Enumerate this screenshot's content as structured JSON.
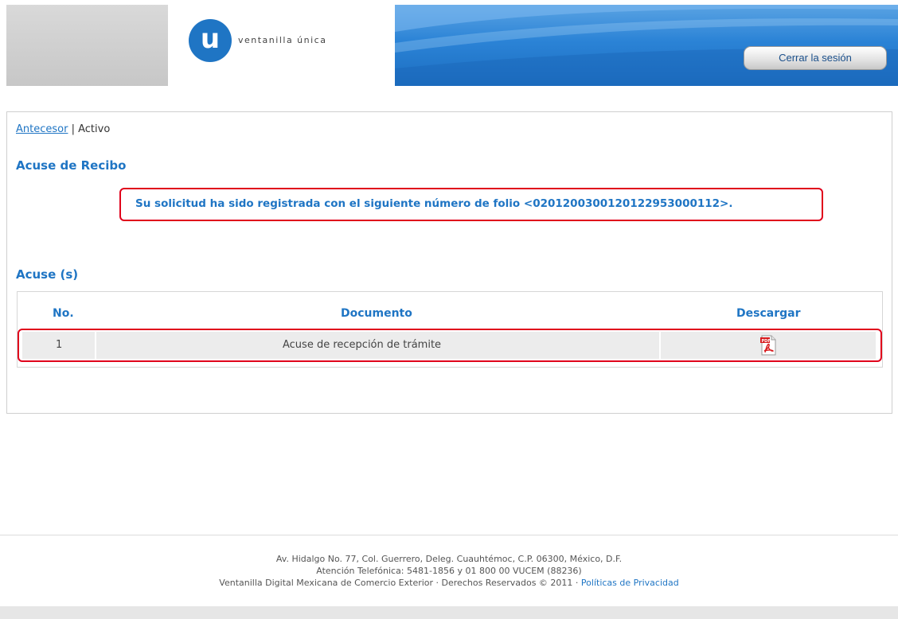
{
  "header": {
    "logo_letter": "u",
    "logo_text": "ventanilla única",
    "logout_label": "Cerrar la sesión"
  },
  "breadcrumb": {
    "link": "Antecesor",
    "separator": " | ",
    "current": "Activo"
  },
  "receipt": {
    "title": "Acuse de Recibo",
    "folio_message": "Su solicitud ha sido registrada con el siguiente número de folio <0201200300120122953000112>."
  },
  "acuses": {
    "title": "Acuse (s)",
    "columns": [
      "No.",
      "Documento",
      "Descargar"
    ],
    "rows": [
      {
        "no": "1",
        "document": "Acuse de recepción de trámite",
        "download_icon": "pdf-icon"
      }
    ]
  },
  "footer": {
    "line1": "Av. Hidalgo No. 77, Col. Guerrero, Deleg. Cuauhtémoc, C.P. 06300, México, D.F.",
    "line2": "Atención Telefónica: 5481-1856 y 01 800 00 VUCEM (88236)",
    "line3": "Ventanilla Digital Mexicana de Comercio Exterior · Derechos Reservados © 2011 · ",
    "privacy_link": "Políticas de Privacidad"
  },
  "colors": {
    "brand_blue": "#1f75c4",
    "highlight_red": "#e0001b"
  }
}
